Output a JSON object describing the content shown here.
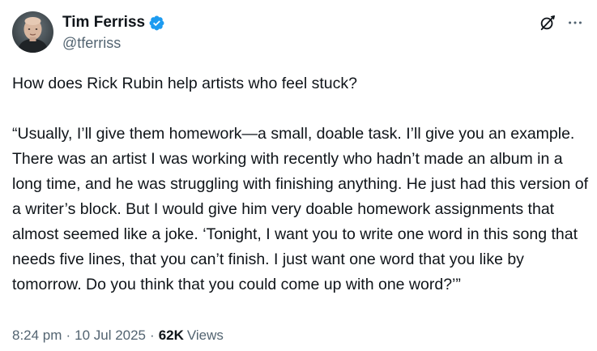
{
  "author": {
    "display_name": "Tim Ferriss",
    "handle": "@tferriss",
    "verified": true,
    "verified_color": "#1d9bf0"
  },
  "icons": {
    "verified": "verified-badge-icon",
    "grok": "grok-icon",
    "more": "more-horizontal-icon"
  },
  "tweet": {
    "paragraphs": [
      "How does Rick Rubin help artists who feel stuck?",
      "“Usually, I’ll give them homework—a small, doable task. I’ll give you an example. There was an artist I was working with recently who hadn’t made an album in a long time, and he was struggling with finishing anything. He just had this version of a writer’s block. But I would give him very doable homework assignments that almost seemed like a joke. ‘Tonight, I want you to write one word in this song that needs five lines, that you can’t finish. I just want one word that you like by tomorrow. Do you think that you could come up with one word?’”"
    ]
  },
  "meta": {
    "time": "8:24 pm",
    "separator_1": "·",
    "date": "10 Jul 2025",
    "separator_2": "·",
    "views_count": "62K",
    "views_label": "Views"
  },
  "colors": {
    "text_primary": "#0f1419",
    "text_secondary": "#536471",
    "accent": "#1d9bf0"
  }
}
